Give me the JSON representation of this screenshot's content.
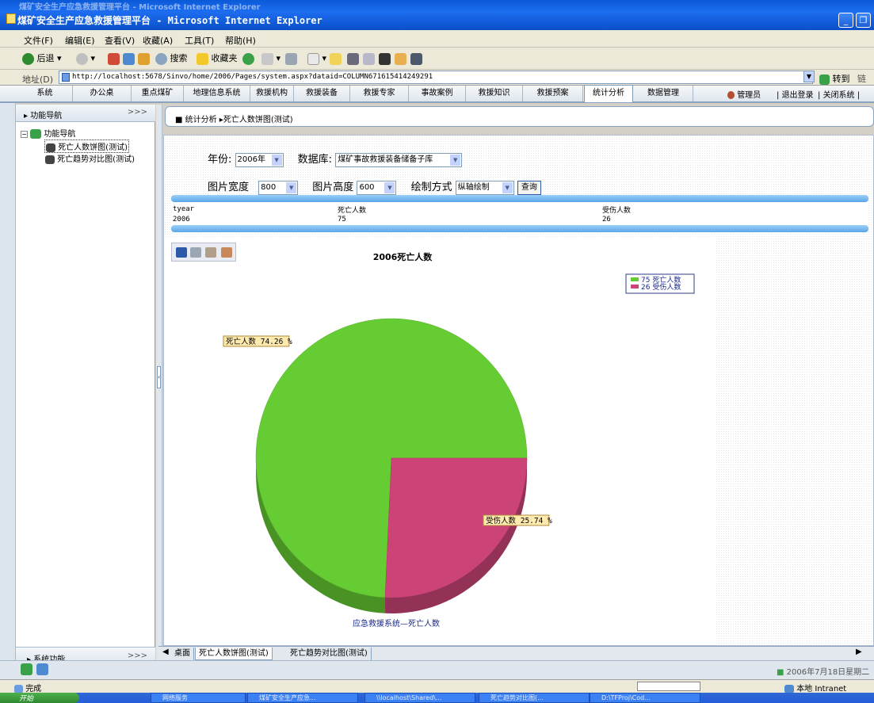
{
  "window": {
    "title": "煤矿安全生产应急救援管理平台 - Microsoft Internet Explorer"
  },
  "menu": [
    "文件(F)",
    "编辑(E)",
    "查看(V)",
    "收藏(A)",
    "工具(T)",
    "帮助(H)"
  ],
  "toolbar": {
    "back": "后退",
    "search": "搜索",
    "favorites": "收藏夹"
  },
  "address": {
    "label": "地址(D)",
    "url": "http://localhost:5678/Sinvo/home/2006/Pages/system.aspx?dataid=COLUMN6716154142492‍91",
    "go": "转到",
    "links": "链接"
  },
  "appnav": {
    "tabs": [
      "系统",
      "办公桌",
      "重点煤矿",
      "地理信息系统",
      "救援机构",
      "救援装备",
      "救援专家",
      "事故案例",
      "救援知识",
      "救援预案",
      "统计分析",
      "数据管理"
    ],
    "active": "统计分析",
    "admin": "管理员",
    "logout": "退出登录",
    "close": "关闭系统"
  },
  "sidebar": {
    "header": "功能导航",
    "tree_root": "功能导航",
    "items": [
      "死亡人数饼图(测试)",
      "死亡趋势对比图(测试)"
    ],
    "footer": "系统功能"
  },
  "breadcrumb": "■ 统计分析 ▸死亡人数饼图(测试)",
  "form": {
    "year_label": "年份:",
    "year_value": "2006年",
    "db_label": "数据库:",
    "db_value": "煤矿事故救援装备储备子库",
    "width_label": "图片宽度",
    "width_value": "800",
    "height_label": "图片高度",
    "height_value": "600",
    "mode_label": "绘制方式",
    "mode_value": "纵轴绘制",
    "query_button": "查询"
  },
  "table": {
    "headers": [
      "tyear",
      "死亡人数",
      "受伤人数"
    ],
    "rows": [
      [
        "2006",
        "75",
        "26"
      ]
    ]
  },
  "chart_data": {
    "type": "pie",
    "title": "2006死亡人数",
    "footer": "应急救援系统—死亡人数",
    "categories": [
      "死亡人数",
      "受伤人数"
    ],
    "values": [
      75,
      26
    ],
    "percent_labels": [
      "死亡人数 74.26 %",
      "受伤人数 25.74 %"
    ],
    "legend": [
      "75 死亡人数",
      "26 受伤人数"
    ],
    "colors": [
      "#66cc33",
      "#cc4477"
    ],
    "legend_position": "top-right"
  },
  "bottom_tabs": [
    "桌面",
    "死亡人数饼图(测试)",
    "死亡趋势对比图(测试)"
  ],
  "date_text": "2006年7月18日星期二",
  "status": {
    "done": "完成",
    "zone": "本地 Intranet"
  },
  "taskbar": {
    "start": "开始",
    "items": [
      "网络服务",
      "煤矿安全生产应急...",
      "\\\\localhost\\Shared\\...",
      "死亡趋势对比图(...",
      "D:\\TFProj\\Cod..."
    ]
  }
}
